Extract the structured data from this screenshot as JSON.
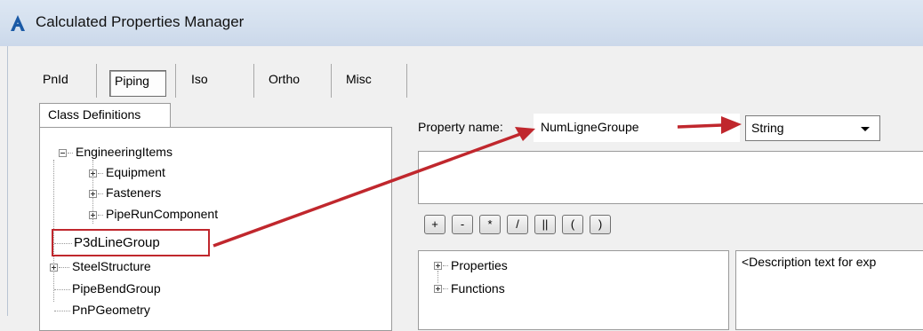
{
  "window": {
    "title": "Calculated Properties Manager",
    "icon": "autocad-a-icon"
  },
  "toolbar": {
    "buttons": [
      {
        "label": "PnId"
      },
      {
        "label": "Piping",
        "pressed": true
      },
      {
        "label": "Iso"
      },
      {
        "label": "Ortho"
      },
      {
        "label": "Misc"
      }
    ]
  },
  "tab": {
    "label": "Class Definitions"
  },
  "tree": {
    "items": [
      {
        "label": "EngineeringItems",
        "expander": "minus"
      },
      {
        "label": "Equipment",
        "expander": "plus"
      },
      {
        "label": "Fasteners",
        "expander": "plus"
      },
      {
        "label": "PipeRunComponent",
        "expander": "plus"
      },
      {
        "label": "P3dLineGroup",
        "expander": "none"
      },
      {
        "label": "SteelStructure",
        "expander": "plus"
      },
      {
        "label": "PipeBendGroup",
        "expander": "none"
      },
      {
        "label": "PnPGeometry",
        "expander": "none"
      }
    ]
  },
  "property": {
    "label": "Property name:",
    "value": "NumLigneGroupe",
    "type": "String"
  },
  "operators": [
    "+",
    "-",
    "*",
    "/",
    "||",
    "(",
    ")"
  ],
  "functions_list": {
    "items": [
      {
        "label": "Properties"
      },
      {
        "label": "Functions"
      }
    ]
  },
  "description": {
    "text": "<Description text for exp"
  },
  "colors": {
    "annotation_red": "#c0272d",
    "titlebar": "#d3dfee"
  }
}
